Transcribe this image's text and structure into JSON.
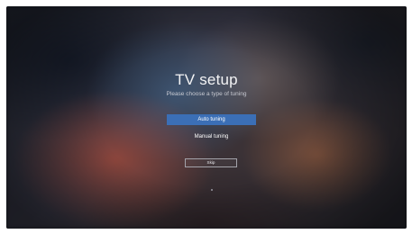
{
  "setup": {
    "title": "TV setup",
    "subtitle": "Please choose a type of tuning",
    "options": [
      {
        "label": "Auto tuning",
        "selected": true
      },
      {
        "label": "Manual tuning",
        "selected": false
      }
    ],
    "skip_label": "Skip"
  },
  "colors": {
    "selected_option": "#3b6fb6",
    "background": "#1b1d25",
    "text": "#ffffff"
  }
}
